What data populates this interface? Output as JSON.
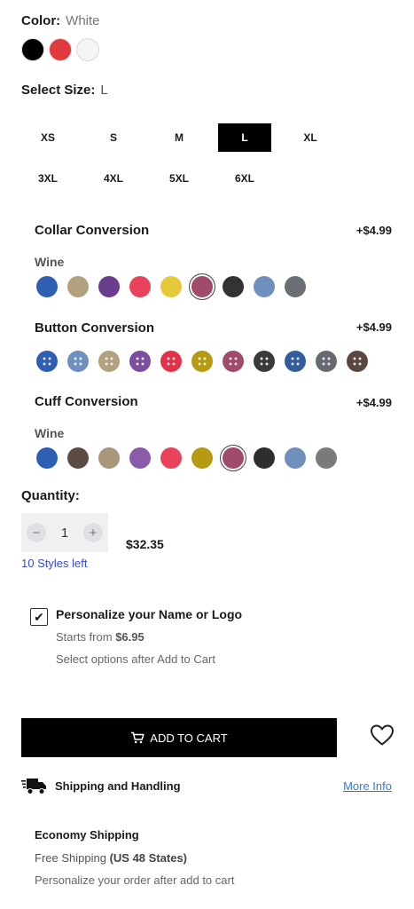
{
  "color": {
    "label": "Color:",
    "value": "White",
    "swatches": [
      {
        "name": "black",
        "hex": "#000000"
      },
      {
        "name": "red",
        "hex": "#e03a3e"
      },
      {
        "name": "white",
        "hex": "#f4f4f6"
      }
    ]
  },
  "size": {
    "label": "Select Size:",
    "value": "L",
    "options": [
      "XS",
      "S",
      "M",
      "L",
      "XL",
      "3XL",
      "4XL",
      "5XL",
      "6XL"
    ]
  },
  "collar": {
    "title": "Collar Conversion",
    "price": "+$4.99",
    "selected_name": "Wine",
    "colors": [
      "#2e5fb3",
      "#b3a07e",
      "#6a3d8f",
      "#e8435a",
      "#e6c93a",
      "#a04a6c",
      "#333333",
      "#6f8fbc",
      "#6b6e75"
    ],
    "selected_color": "#a04a6c"
  },
  "buttons": {
    "title": "Button Conversion",
    "price": "+$4.99",
    "colors": [
      "#2e5fb3",
      "#6f8fbc",
      "#b3a07e",
      "#7c4f9e",
      "#e0334a",
      "#b59a12",
      "#a04a6c",
      "#3a3a3a",
      "#345d9b",
      "#666a70",
      "#5a4840"
    ]
  },
  "cuff": {
    "title": "Cuff Conversion",
    "price": "+$4.99",
    "selected_name": "Wine",
    "colors": [
      "#2e5fb3",
      "#5e4a44",
      "#a8977a",
      "#8a5bab",
      "#e8435a",
      "#b59a12",
      "#a04a6c",
      "#2e2e2e",
      "#6f8fbc",
      "#7a7a7a"
    ],
    "selected_color": "#a04a6c"
  },
  "quantity": {
    "label": "Quantity:",
    "value": "1",
    "minus": "−",
    "plus": "+",
    "price": "$32.35",
    "styles_left": "10 Styles left"
  },
  "personalize": {
    "checked": true,
    "check_mark": "✔",
    "title": "Personalize your Name or Logo",
    "starts_from_prefix": "Starts from",
    "starts_from_price": "$6.95",
    "note": "Select options after Add to Cart"
  },
  "cart": {
    "label": "ADD TO CART"
  },
  "shipping": {
    "title": "Shipping and Handling",
    "more_info": "More Info",
    "economy_title": "Economy Shipping",
    "free_prefix": "Free Shipping",
    "free_region": "(US 48 States)",
    "note": "Personalize your order after add to cart"
  }
}
